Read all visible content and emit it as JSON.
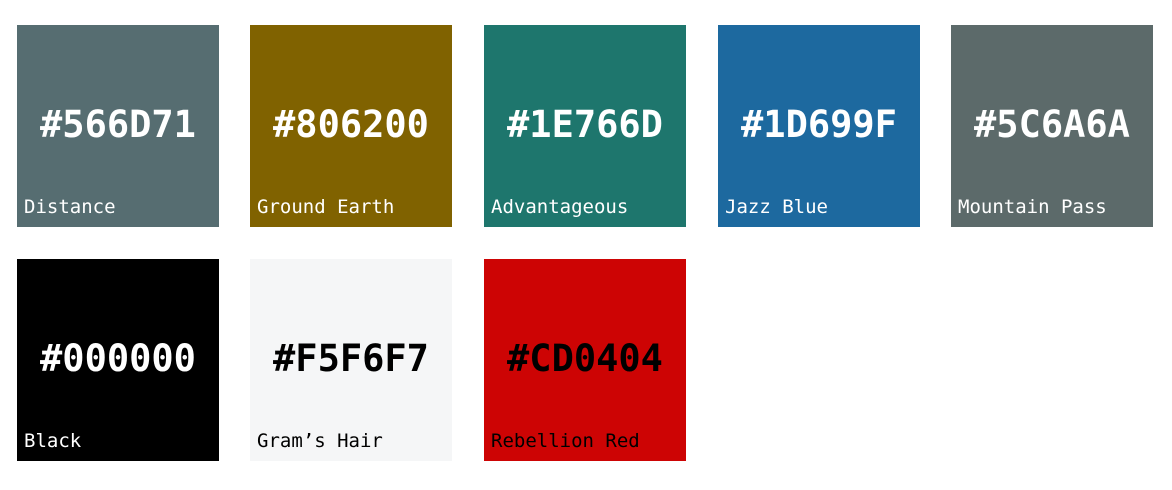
{
  "swatches": [
    {
      "hex": "#566D71",
      "name": "Distance",
      "color": "#566D71",
      "text_color": "#ffffff"
    },
    {
      "hex": "#806200",
      "name": "Ground Earth",
      "color": "#806200",
      "text_color": "#ffffff"
    },
    {
      "hex": "#1E766D",
      "name": "Advantageous",
      "color": "#1E766D",
      "text_color": "#ffffff"
    },
    {
      "hex": "#1D699F",
      "name": "Jazz Blue",
      "color": "#1D699F",
      "text_color": "#ffffff"
    },
    {
      "hex": "#5C6A6A",
      "name": "Mountain Pass",
      "color": "#5C6A6A",
      "text_color": "#ffffff"
    },
    {
      "hex": "#000000",
      "name": "Black",
      "color": "#000000",
      "text_color": "#ffffff"
    },
    {
      "hex": "#F5F6F7",
      "name": "Gram’s Hair",
      "color": "#F5F6F7",
      "text_color": "#000000"
    },
    {
      "hex": "#CD0404",
      "name": "Rebellion Red",
      "color": "#CD0404",
      "text_color": "#000000"
    }
  ]
}
